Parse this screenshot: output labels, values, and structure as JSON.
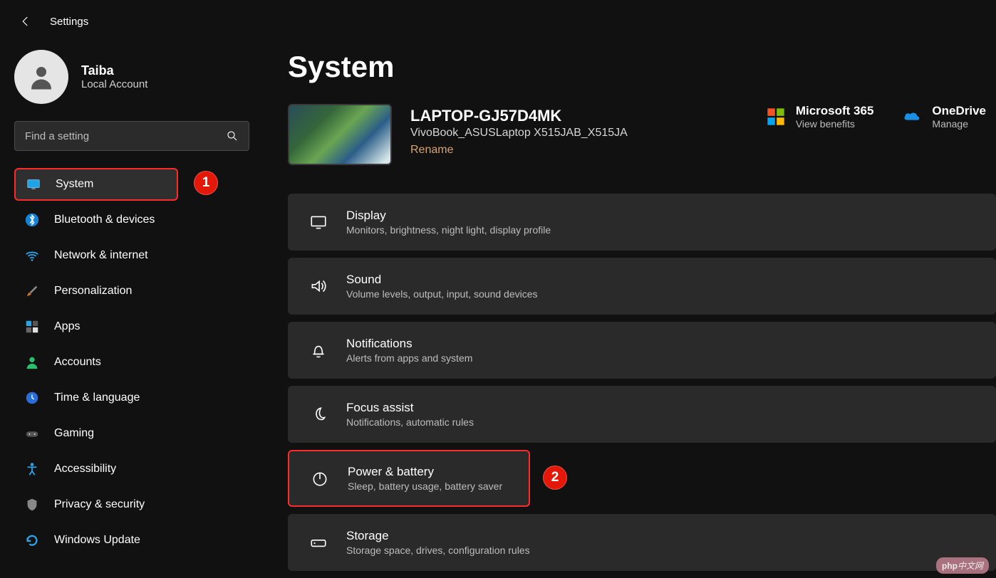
{
  "app_title": "Settings",
  "page_title": "System",
  "user": {
    "name": "Taiba",
    "subtitle": "Local Account"
  },
  "search": {
    "placeholder": "Find a setting"
  },
  "nav": [
    {
      "key": "system",
      "label": "System"
    },
    {
      "key": "bluetooth",
      "label": "Bluetooth & devices"
    },
    {
      "key": "network",
      "label": "Network & internet"
    },
    {
      "key": "personalization",
      "label": "Personalization"
    },
    {
      "key": "apps",
      "label": "Apps"
    },
    {
      "key": "accounts",
      "label": "Accounts"
    },
    {
      "key": "time",
      "label": "Time & language"
    },
    {
      "key": "gaming",
      "label": "Gaming"
    },
    {
      "key": "accessibility",
      "label": "Accessibility"
    },
    {
      "key": "privacy",
      "label": "Privacy & security"
    },
    {
      "key": "update",
      "label": "Windows Update"
    }
  ],
  "device": {
    "name": "LAPTOP-GJ57D4MK",
    "model": "VivoBook_ASUSLaptop X515JAB_X515JA",
    "rename": "Rename"
  },
  "quicklinks": {
    "m365": {
      "title": "Microsoft 365",
      "sub": "View benefits"
    },
    "onedrive": {
      "title": "OneDrive",
      "sub": "Manage"
    }
  },
  "cards": [
    {
      "key": "display",
      "title": "Display",
      "sub": "Monitors, brightness, night light, display profile"
    },
    {
      "key": "sound",
      "title": "Sound",
      "sub": "Volume levels, output, input, sound devices"
    },
    {
      "key": "notifications",
      "title": "Notifications",
      "sub": "Alerts from apps and system"
    },
    {
      "key": "focus",
      "title": "Focus assist",
      "sub": "Notifications, automatic rules"
    },
    {
      "key": "power",
      "title": "Power & battery",
      "sub": "Sleep, battery usage, battery saver"
    },
    {
      "key": "storage",
      "title": "Storage",
      "sub": "Storage space, drives, configuration rules"
    }
  ],
  "callouts": {
    "nav_num": "1",
    "card_num": "2"
  },
  "watermark": {
    "left": "php",
    "right": "中文网"
  }
}
